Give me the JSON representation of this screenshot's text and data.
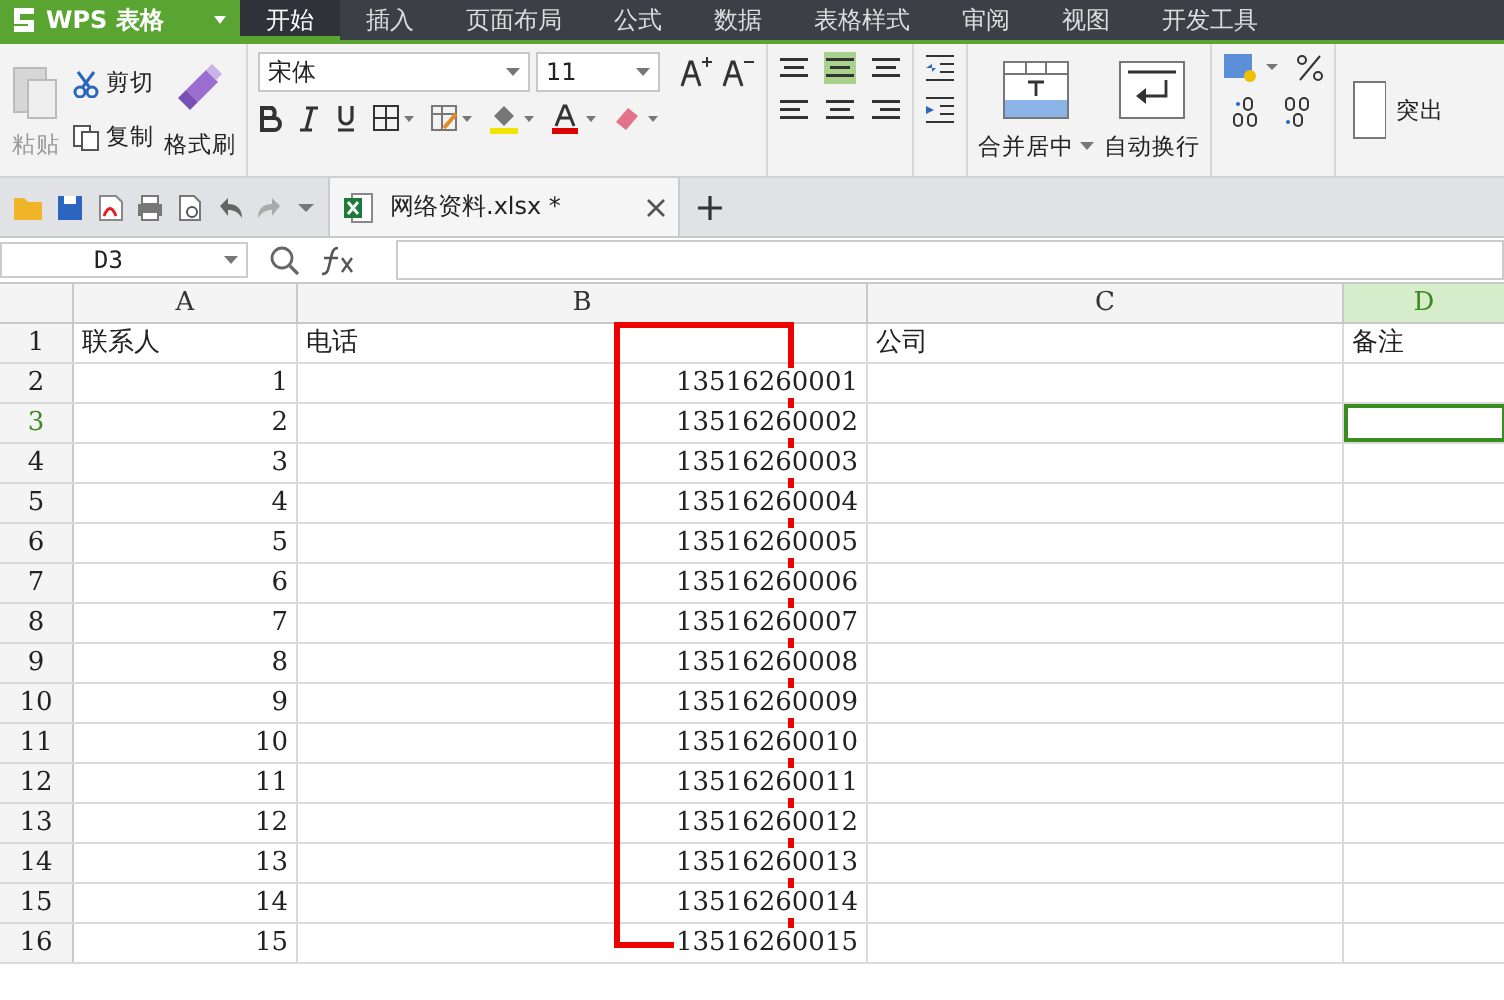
{
  "app_menu": {
    "label": "WPS 表格"
  },
  "menu_tabs": [
    {
      "label": "开始",
      "selected": true
    },
    {
      "label": "插入",
      "selected": false
    },
    {
      "label": "页面布局",
      "selected": false
    },
    {
      "label": "公式",
      "selected": false
    },
    {
      "label": "数据",
      "selected": false
    },
    {
      "label": "表格样式",
      "selected": false
    },
    {
      "label": "审阅",
      "selected": false
    },
    {
      "label": "视图",
      "selected": false
    },
    {
      "label": "开发工具",
      "selected": false
    }
  ],
  "ribbon": {
    "paste": "粘贴",
    "cut": "剪切",
    "copy": "复制",
    "format_painter": "格式刷",
    "font_name": "宋体",
    "font_size": "11",
    "merge": "合并居中",
    "wrap": "自动换行",
    "highlight": "突出",
    "align_center_selected": true
  },
  "document_tab": {
    "title": "网络资料.xlsx *"
  },
  "name_box": {
    "value": "D3"
  },
  "columns": [
    {
      "label": "A",
      "selected": false
    },
    {
      "label": "B",
      "selected": false
    },
    {
      "label": "C",
      "selected": false
    },
    {
      "label": "D",
      "selected": true
    }
  ],
  "rows": [
    {
      "number": "1",
      "selected": false,
      "cells": [
        "联系人",
        "电话",
        "公司",
        "备注"
      ]
    },
    {
      "number": "2",
      "selected": false,
      "cells": [
        "1",
        "13516260001",
        "",
        ""
      ]
    },
    {
      "number": "3",
      "selected": true,
      "cells": [
        "2",
        "13516260002",
        "",
        ""
      ]
    },
    {
      "number": "4",
      "selected": false,
      "cells": [
        "3",
        "13516260003",
        "",
        ""
      ]
    },
    {
      "number": "5",
      "selected": false,
      "cells": [
        "4",
        "13516260004",
        "",
        ""
      ]
    },
    {
      "number": "6",
      "selected": false,
      "cells": [
        "5",
        "13516260005",
        "",
        ""
      ]
    },
    {
      "number": "7",
      "selected": false,
      "cells": [
        "6",
        "13516260006",
        "",
        ""
      ]
    },
    {
      "number": "8",
      "selected": false,
      "cells": [
        "7",
        "13516260007",
        "",
        ""
      ]
    },
    {
      "number": "9",
      "selected": false,
      "cells": [
        "8",
        "13516260008",
        "",
        ""
      ]
    },
    {
      "number": "10",
      "selected": false,
      "cells": [
        "9",
        "13516260009",
        "",
        ""
      ]
    },
    {
      "number": "11",
      "selected": false,
      "cells": [
        "10",
        "13516260010",
        "",
        ""
      ]
    },
    {
      "number": "12",
      "selected": false,
      "cells": [
        "11",
        "13516260011",
        "",
        ""
      ]
    },
    {
      "number": "13",
      "selected": false,
      "cells": [
        "12",
        "13516260012",
        "",
        ""
      ]
    },
    {
      "number": "14",
      "selected": false,
      "cells": [
        "13",
        "13516260013",
        "",
        ""
      ]
    },
    {
      "number": "15",
      "selected": false,
      "cells": [
        "14",
        "13516260014",
        "",
        ""
      ]
    },
    {
      "number": "16",
      "selected": false,
      "cells": [
        "15",
        "13516260015",
        "",
        ""
      ]
    }
  ]
}
